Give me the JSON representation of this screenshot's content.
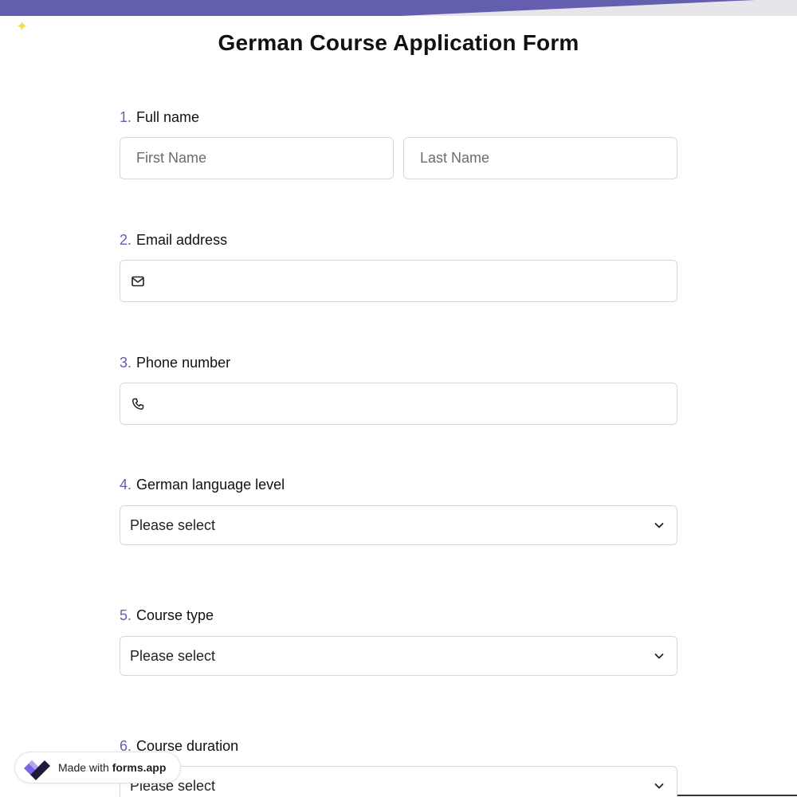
{
  "form": {
    "title": "German Course Application Form"
  },
  "questions": [
    {
      "number": "1.",
      "label": "Full name",
      "fields": [
        {
          "placeholder": "First Name"
        },
        {
          "placeholder": "Last Name"
        }
      ]
    },
    {
      "number": "2.",
      "label": "Email address",
      "icon": "envelope-icon",
      "value": ""
    },
    {
      "number": "3.",
      "label": "Phone number",
      "icon": "phone-icon",
      "value": ""
    },
    {
      "number": "4.",
      "label": "German language level",
      "selected": "Please select"
    },
    {
      "number": "5.",
      "label": "Course type",
      "selected": "Please select"
    },
    {
      "number": "6.",
      "label": "Course duration",
      "selected": "Please select"
    }
  ],
  "badge": {
    "prefix": "Made with",
    "brand": "forms.app"
  },
  "colors": {
    "accent": "#635fae",
    "sparkle": "#f3dc45"
  }
}
